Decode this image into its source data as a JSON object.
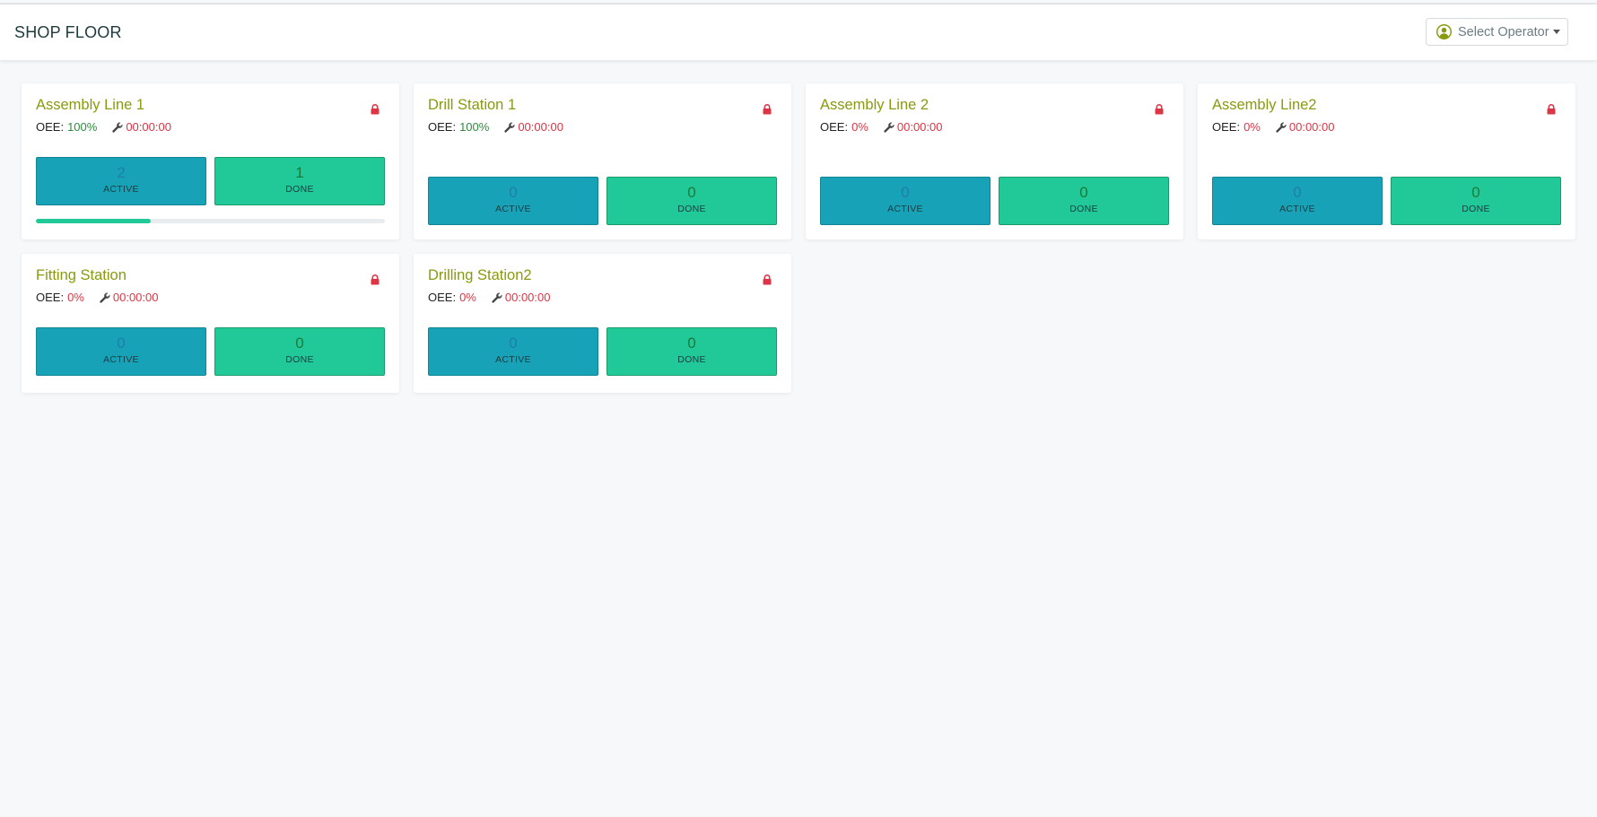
{
  "header": {
    "title": "SHOP FLOOR",
    "operator_button": "Select Operator"
  },
  "colors": {
    "station_title": "#8a9a0f",
    "active": "#17a2b8",
    "done": "#20c997",
    "alert": "#dc3545",
    "good": "#2e8b3e"
  },
  "stations": [
    {
      "name": "Assembly Line 1",
      "oee_label": "OEE:",
      "oee": "100%",
      "timer": "00:00:00",
      "active": "2",
      "active_label": "ACTIVE",
      "done": "1",
      "done_label": "DONE",
      "progress": 0.33
    },
    {
      "name": "Drill Station 1",
      "oee_label": "OEE:",
      "oee": "100%",
      "timer": "00:00:00",
      "active": "0",
      "active_label": "ACTIVE",
      "done": "0",
      "done_label": "DONE"
    },
    {
      "name": "Assembly Line 2",
      "oee_label": "OEE:",
      "oee": "0%",
      "timer": "00:00:00",
      "active": "0",
      "active_label": "ACTIVE",
      "done": "0",
      "done_label": "DONE"
    },
    {
      "name": "Assembly Line2",
      "oee_label": "OEE:",
      "oee": "0%",
      "timer": "00:00:00",
      "active": "0",
      "active_label": "ACTIVE",
      "done": "0",
      "done_label": "DONE"
    },
    {
      "name": "Fitting Station",
      "oee_label": "OEE:",
      "oee": "0%",
      "timer": "00:00:00",
      "active": "0",
      "active_label": "ACTIVE",
      "done": "0",
      "done_label": "DONE"
    },
    {
      "name": "Drilling Station2",
      "oee_label": "OEE:",
      "oee": "0%",
      "timer": "00:00:00",
      "active": "0",
      "active_label": "ACTIVE",
      "done": "0",
      "done_label": "DONE"
    }
  ]
}
